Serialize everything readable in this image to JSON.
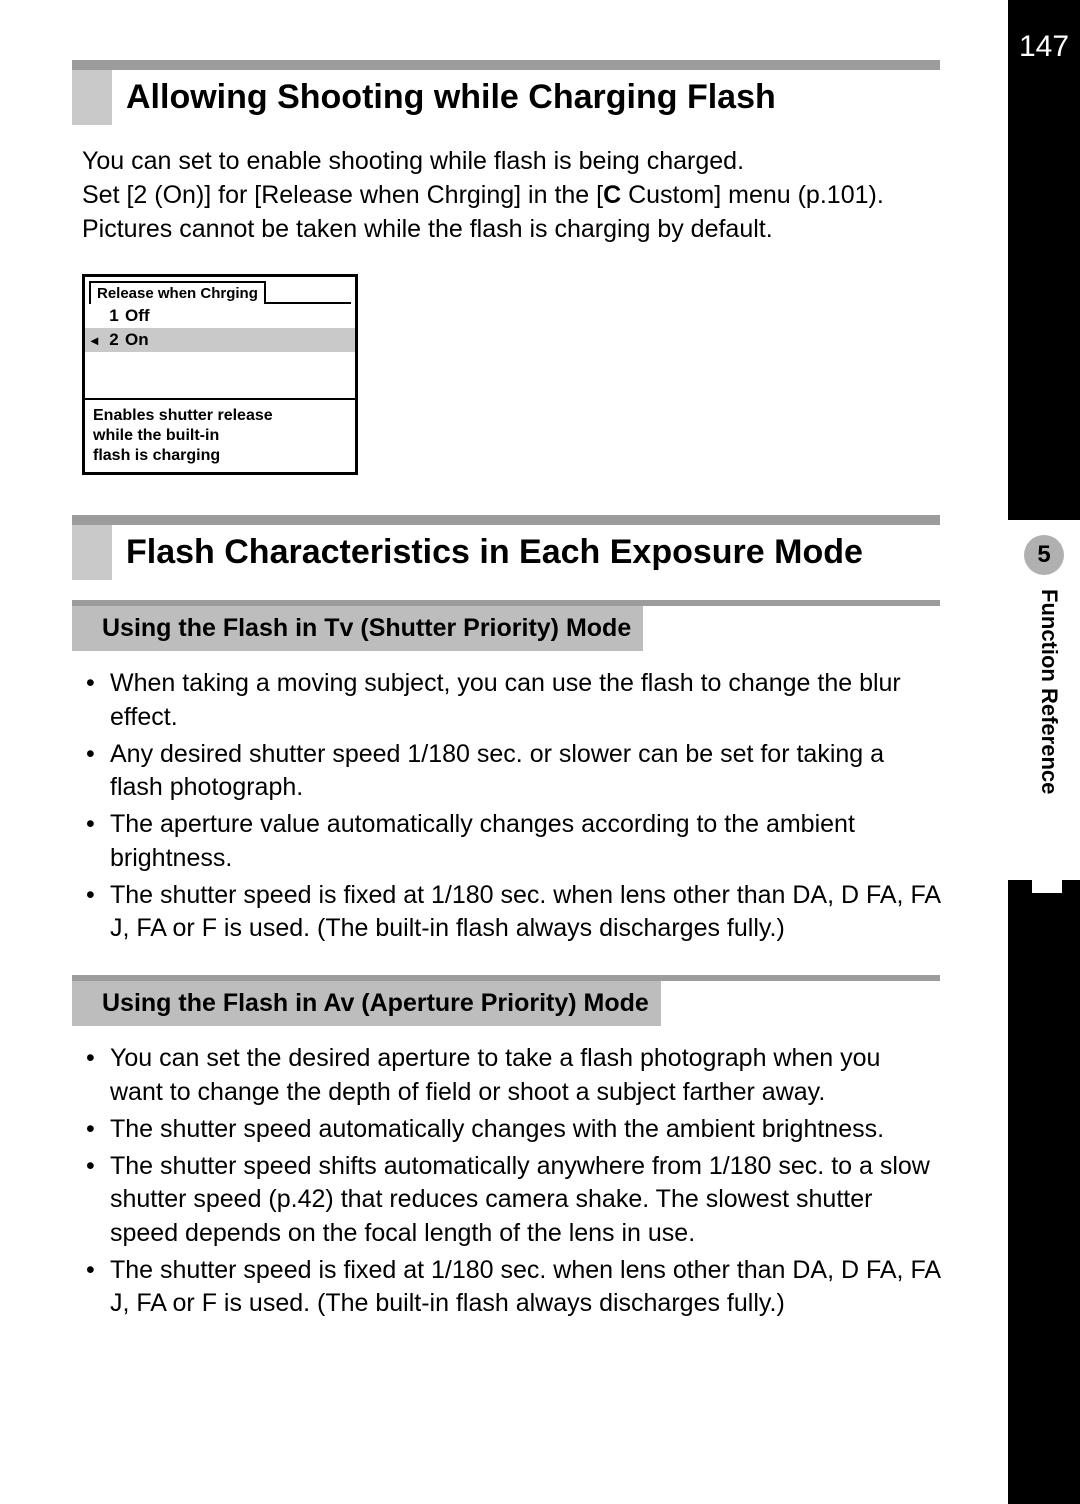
{
  "page_number": "147",
  "chapter_number": "5",
  "chapter_label": "Function Reference",
  "section1": {
    "title": "Allowing Shooting while Charging Flash",
    "paragraph_line1": "You can set to enable shooting while flash is being charged.",
    "paragraph_line2a": "Set [2 (On)] for [Release when Chrging] in the [",
    "paragraph_line2_menu_icon": "C",
    "paragraph_line2b": " Custom] menu (p.101).",
    "paragraph_line3": "Pictures cannot be taken while the flash is charging by default."
  },
  "lcd": {
    "tab_title": "Release when Chrging",
    "option1_num": "1",
    "option1_label": "Off",
    "option2_arrow": "◂",
    "option2_num": "2",
    "option2_label": "On",
    "description_line1": "Enables shutter release",
    "description_line2": "while the built-in",
    "description_line3": "flash is charging"
  },
  "section2": {
    "title": "Flash Characteristics in Each Exposure Mode"
  },
  "sub_tv": {
    "title_pre": "Using the Flash in ",
    "title_mode": "Tv",
    "title_post": " (Shutter Priority) Mode",
    "bullets": [
      "When taking a moving subject, you can use the flash to change the blur effect.",
      "Any desired shutter speed 1/180 sec. or slower can be set for taking a flash photograph.",
      "The aperture value automatically changes according to the ambient brightness.",
      "The shutter speed is fixed at 1/180 sec. when lens other than DA, D FA, FA J, FA or F is used. (The built-in flash always discharges fully.)"
    ]
  },
  "sub_av": {
    "title": "Using the Flash in Av (Aperture Priority) Mode",
    "bullets": [
      "You can set the desired aperture to take a flash photograph when you want to change the depth of field or shoot a subject farther away.",
      "The shutter speed automatically changes with the ambient brightness.",
      "The shutter speed shifts automatically anywhere from 1/180 sec. to a slow shutter speed (p.42) that reduces camera shake. The slowest shutter speed depends on the focal length of the lens in use.",
      "The shutter speed is fixed at 1/180 sec. when lens other than DA, D FA, FA J, FA or F is used. (The built-in flash always discharges fully.)"
    ]
  }
}
